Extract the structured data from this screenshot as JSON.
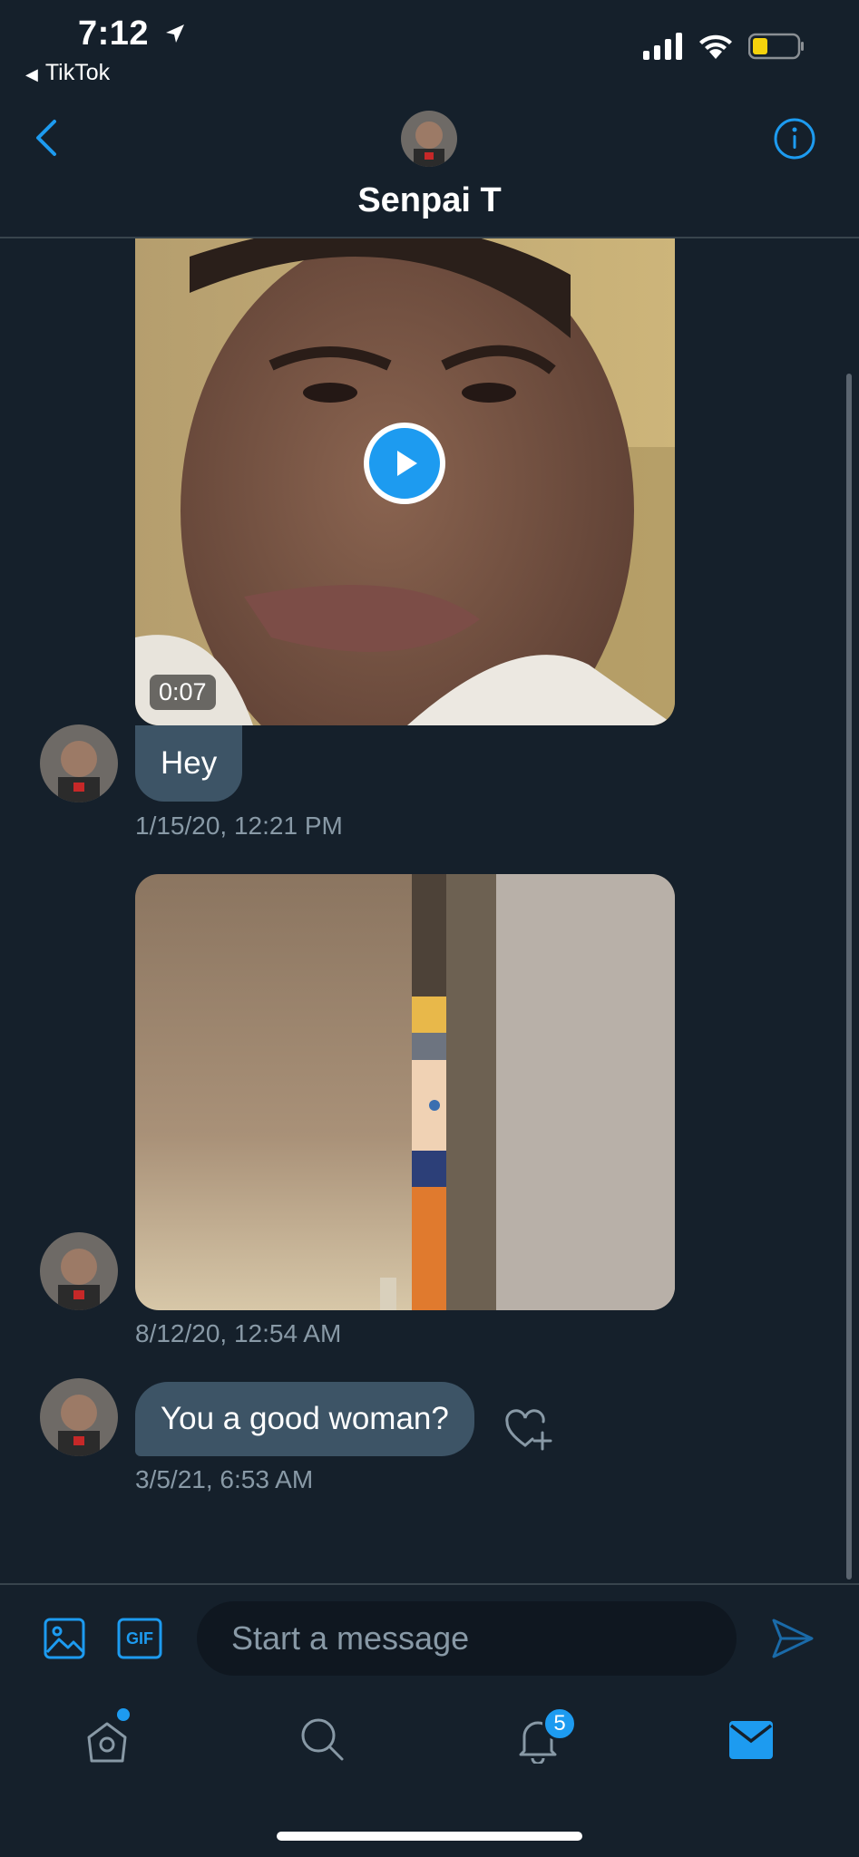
{
  "status_bar": {
    "time": "7:12",
    "back_app": "TikTok"
  },
  "header": {
    "contact_name": "Senpai T"
  },
  "messages": [
    {
      "type": "video",
      "duration": "0:07",
      "text": "Hey",
      "timestamp": "1/15/20, 12:21 PM"
    },
    {
      "type": "image",
      "timestamp": "8/12/20, 12:54 AM"
    },
    {
      "type": "text",
      "text": "You a good woman?",
      "timestamp": "3/5/21, 6:53 AM"
    }
  ],
  "composer": {
    "placeholder": "Start a message",
    "gif_label": "GIF"
  },
  "tab_bar": {
    "notifications_badge": "5"
  },
  "colors": {
    "background": "#15202b",
    "accent": "#1d9bf0",
    "bubble": "#3d5466",
    "secondary_text": "#8899a6"
  }
}
